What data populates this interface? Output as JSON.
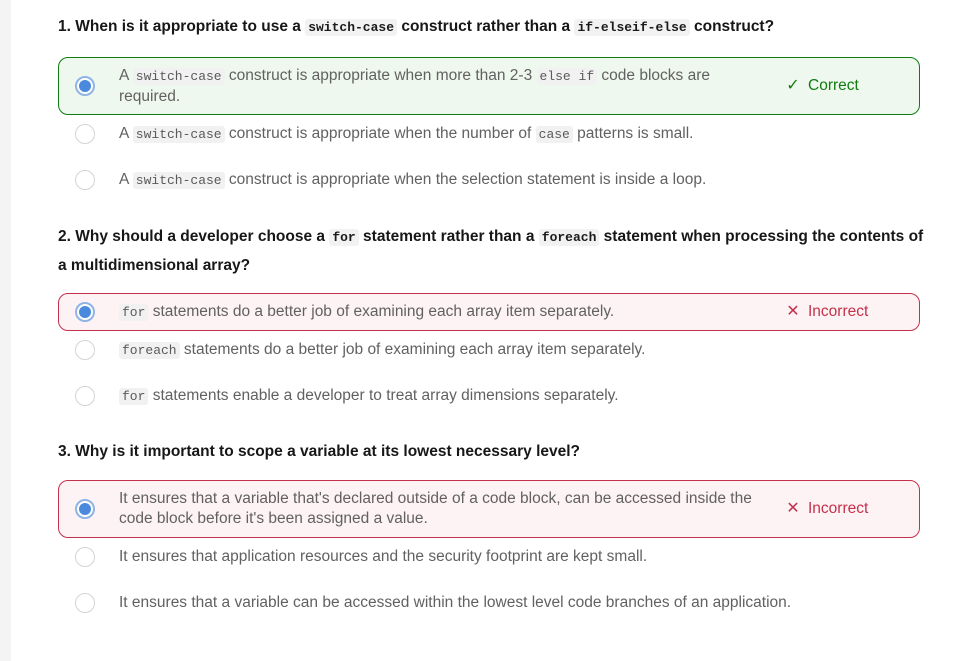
{
  "questions": [
    {
      "title_parts": [
        "1. When is it appropriate to use a ",
        "switch-case",
        " construct rather than a ",
        "if-elseif-else",
        " construct?"
      ],
      "options": [
        {
          "parts": [
            "A ",
            "switch-case",
            " construct is appropriate when more than 2-3 ",
            "else if",
            " code blocks are required."
          ],
          "selected": true,
          "feedback": "Correct"
        },
        {
          "parts": [
            "A ",
            "switch-case",
            " construct is appropriate when the number of ",
            "case",
            " patterns is small."
          ],
          "selected": false
        },
        {
          "parts": [
            "A ",
            "switch-case",
            " construct is appropriate when the selection statement is inside a loop."
          ],
          "selected": false
        }
      ]
    },
    {
      "title_parts": [
        "2. Why should a developer choose a ",
        "for",
        " statement rather than a ",
        "foreach",
        " statement when processing the contents of a multidimensional array?"
      ],
      "options": [
        {
          "parts": [
            "",
            "for",
            " statements do a better job of examining each array item separately."
          ],
          "selected": true,
          "feedback": "Incorrect"
        },
        {
          "parts": [
            "",
            "foreach",
            " statements do a better job of examining each array item separately."
          ],
          "selected": false
        },
        {
          "parts": [
            "",
            "for",
            " statements enable a developer to treat array dimensions separately."
          ],
          "selected": false
        }
      ]
    },
    {
      "title": "3. Why is it important to scope a variable at its lowest necessary level?",
      "options": [
        {
          "text": "It ensures that a variable that's declared outside of a code block, can be accessed inside the code block before it's been assigned a value.",
          "selected": true,
          "feedback": "Incorrect"
        },
        {
          "text": "It ensures that application resources and the security footprint are kept small.",
          "selected": false
        },
        {
          "text": "It ensures that a variable can be accessed within the lowest level code branches of an application.",
          "selected": false
        }
      ]
    }
  ],
  "icons": {
    "correct": "checkmark-icon",
    "incorrect": "x-mark-icon"
  },
  "colors": {
    "correct": "#107c10",
    "incorrect": "#c4314b",
    "radio_selected": "#4a89dc"
  }
}
